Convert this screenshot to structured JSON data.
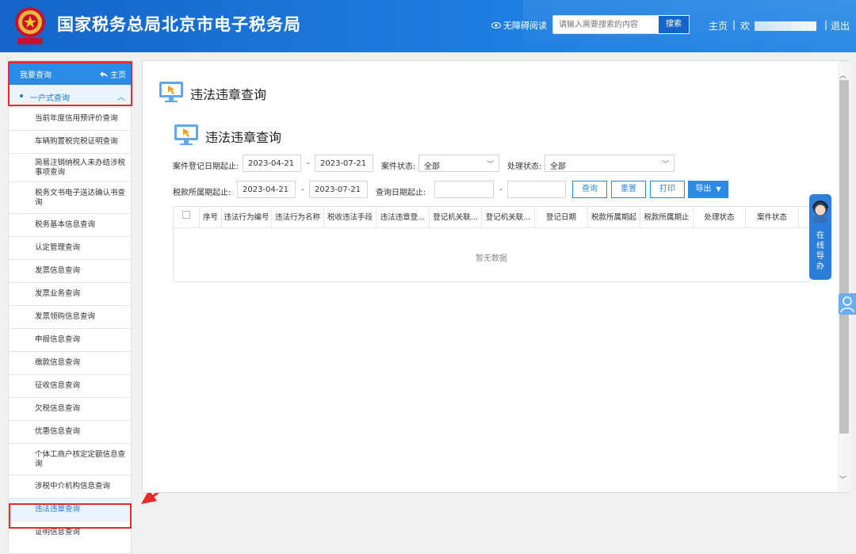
{
  "header": {
    "site_title": "国家税务总局北京市电子税务局",
    "accessibility_label": "无障碍阅读",
    "search_placeholder": "请输入需要搜索的内容",
    "search_button": "搜索",
    "home_link": "主页",
    "separator": "|",
    "welcome": "欢",
    "logout": "退出"
  },
  "sidebar": {
    "section_title": "我要查询",
    "home_label": "主页",
    "group_label": "一户式查询",
    "items": [
      {
        "label": "当前年度信用预评价查询"
      },
      {
        "label": "车辆购置税完税证明查询"
      },
      {
        "label": "简易注销纳税人未办结涉税事项查询"
      },
      {
        "label": "税务文书电子送达确认书查询"
      },
      {
        "label": "税务基本信息查询"
      },
      {
        "label": "认定管理查询"
      },
      {
        "label": "发票信息查询"
      },
      {
        "label": "发票业务查询"
      },
      {
        "label": "发票领购信息查询"
      },
      {
        "label": "申报信息查询"
      },
      {
        "label": "缴款信息查询"
      },
      {
        "label": "征收信息查询"
      },
      {
        "label": "欠税信息查询"
      },
      {
        "label": "优惠信息查询"
      },
      {
        "label": "个体工商户核定定额信息查询"
      },
      {
        "label": "涉税中介机构信息查询"
      },
      {
        "label": "违法违章查询"
      },
      {
        "label": "证明信息查询"
      }
    ],
    "active_item": "违法违章查询"
  },
  "main": {
    "page_title": "违法违章查询",
    "card_title": "违法违章查询",
    "filters": {
      "case_date_label": "案件登记日期起止:",
      "case_date_from": "2023-04-21",
      "case_date_to": "2023-07-21",
      "dash": "-",
      "case_status_label": "案件状态:",
      "case_status_value": "全部",
      "process_status_label": "处理状态:",
      "process_status_value": "全部",
      "tax_period_label": "税款所属期起止:",
      "tax_period_from": "2023-04-21",
      "tax_period_to": "2023-07-21",
      "query_date_label": "查询日期起止:",
      "query_date_from": "",
      "query_date_to": ""
    },
    "buttons": {
      "query": "查询",
      "reset": "重置",
      "print": "打印",
      "export": "导出"
    },
    "table": {
      "columns": [
        "序号",
        "违法行为编号",
        "违法行为名称",
        "税收违法手段",
        "违法违章登...",
        "登记机关联...",
        "登记机关联...",
        "登记日期",
        "税款所属期起",
        "税款所属期止",
        "处理状态",
        "案件状态"
      ],
      "empty_text": "暂无数据"
    }
  },
  "floating": {
    "online_service": "在线导办"
  },
  "colors": {
    "header_blue": "#1f7fe0",
    "accent": "#2b8ae6",
    "highlight_red": "#e52b2b"
  }
}
